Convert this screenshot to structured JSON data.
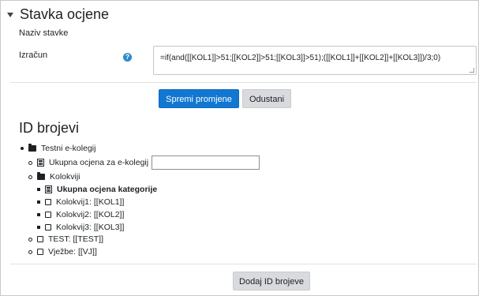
{
  "section": {
    "title": "Stavka ocjene"
  },
  "fields": {
    "name_label": "Naziv stavke",
    "calc_label": "Izračun",
    "help_glyph": "?",
    "formula": "=if(and([[KOL1]]>51;[[KOL2]]>51;[[KOL3]]>51);([[KOL1]]+[[KOL2]]+[[KOL3]])/3;0)"
  },
  "buttons": {
    "save": "Spremi promjene",
    "cancel": "Odustani",
    "add_ids": "Dodaj ID brojeve"
  },
  "ids": {
    "title": "ID brojevi",
    "tree": {
      "root": "Testni e-kolegij",
      "course_total": "Ukupna ocjena za e-kolegij",
      "course_total_value": "",
      "category": "Kolokviji",
      "category_total": "Ukupna ocjena kategorije",
      "items": [
        "Kolokvij1: [[KOL1]]",
        "Kolokvij2: [[KOL2]]",
        "Kolokvij3: [[KOL3]]"
      ],
      "test": "TEST: [[TEST]]",
      "vjezbe": "Vježbe: [[VJ]]"
    }
  },
  "colors": {
    "primary": "#1177d1",
    "secondary": "#d8dadd",
    "help": "#2b8ac6"
  }
}
